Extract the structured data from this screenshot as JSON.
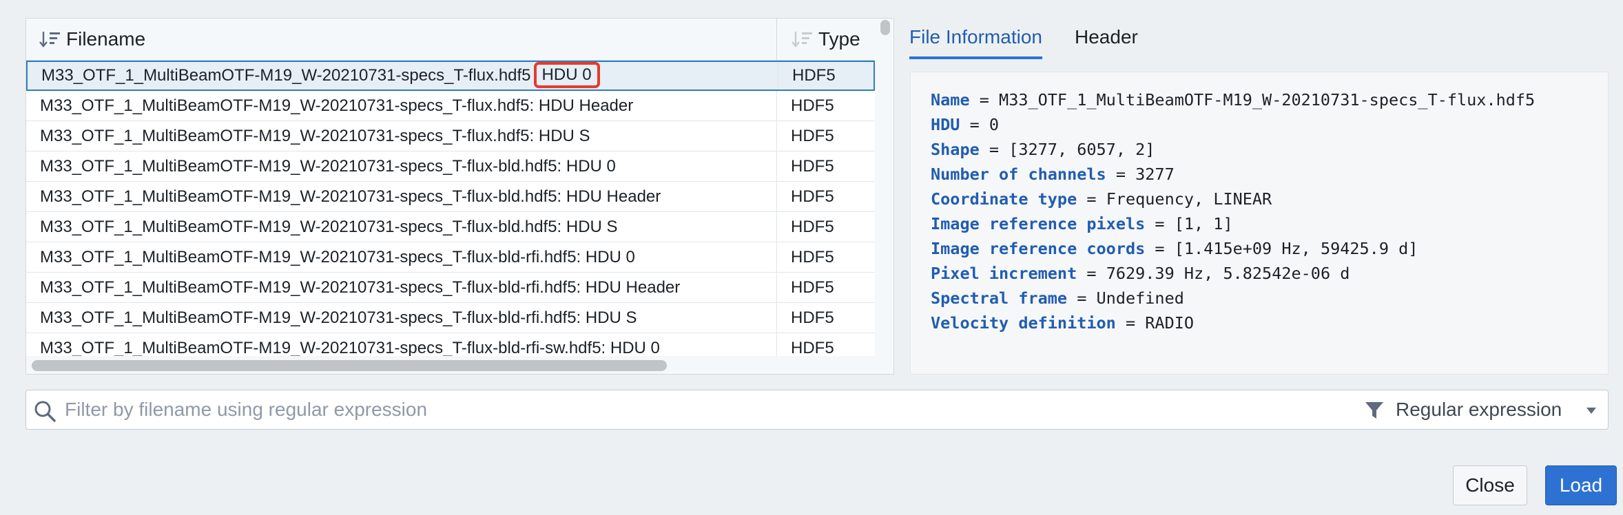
{
  "table": {
    "columns": {
      "filename": "Filename",
      "type": "Type"
    },
    "rows": [
      {
        "filename": "M33_OTF_1_MultiBeamOTF-M19_W-20210731-specs_T-flux.hdf5",
        "hdu": "HDU 0",
        "type": "HDF5",
        "selected": true
      },
      {
        "filename": "M33_OTF_1_MultiBeamOTF-M19_W-20210731-specs_T-flux.hdf5: HDU Header",
        "type": "HDF5"
      },
      {
        "filename": "M33_OTF_1_MultiBeamOTF-M19_W-20210731-specs_T-flux.hdf5: HDU S",
        "type": "HDF5"
      },
      {
        "filename": "M33_OTF_1_MultiBeamOTF-M19_W-20210731-specs_T-flux-bld.hdf5: HDU 0",
        "type": "HDF5"
      },
      {
        "filename": "M33_OTF_1_MultiBeamOTF-M19_W-20210731-specs_T-flux-bld.hdf5: HDU Header",
        "type": "HDF5"
      },
      {
        "filename": "M33_OTF_1_MultiBeamOTF-M19_W-20210731-specs_T-flux-bld.hdf5: HDU S",
        "type": "HDF5"
      },
      {
        "filename": "M33_OTF_1_MultiBeamOTF-M19_W-20210731-specs_T-flux-bld-rfi.hdf5: HDU 0",
        "type": "HDF5"
      },
      {
        "filename": "M33_OTF_1_MultiBeamOTF-M19_W-20210731-specs_T-flux-bld-rfi.hdf5: HDU Header",
        "type": "HDF5"
      },
      {
        "filename": "M33_OTF_1_MultiBeamOTF-M19_W-20210731-specs_T-flux-bld-rfi.hdf5: HDU S",
        "type": "HDF5"
      },
      {
        "filename": "M33_OTF_1_MultiBeamOTF-M19_W-20210731-specs_T-flux-bld-rfi-sw.hdf5: HDU 0",
        "type": "HDF5"
      }
    ]
  },
  "tabs": {
    "file_info": "File Information",
    "header": "Header"
  },
  "info": [
    {
      "key": "Name",
      "value": "M33_OTF_1_MultiBeamOTF-M19_W-20210731-specs_T-flux.hdf5"
    },
    {
      "key": "HDU",
      "value": "0"
    },
    {
      "key": "Shape",
      "value": "[3277, 6057, 2]"
    },
    {
      "key": "Number of channels",
      "value": "3277"
    },
    {
      "key": "Coordinate type",
      "value": "Frequency, LINEAR"
    },
    {
      "key": "Image reference pixels",
      "value": "[1, 1]"
    },
    {
      "key": "Image reference coords",
      "value": "[1.415e+09 Hz, 59425.9 d]"
    },
    {
      "key": "Pixel increment",
      "value": "7629.39 Hz, 5.82542e-06 d"
    },
    {
      "key": "Spectral frame",
      "value": "Undefined"
    },
    {
      "key": "Velocity definition",
      "value": "RADIO"
    }
  ],
  "filter": {
    "placeholder": "Filter by filename using regular expression",
    "value": "",
    "mode_label": "Regular expression"
  },
  "buttons": {
    "close": "Close",
    "load": "Load"
  },
  "colors": {
    "accent": "#2d72d2",
    "key": "#215db0",
    "highlight": "#e8392b",
    "selected_row": "#e6eff6"
  },
  "icons": {
    "sort": "sort-desc-icon",
    "search": "search-icon",
    "filter": "filter-icon",
    "caret": "caret-down-icon"
  }
}
